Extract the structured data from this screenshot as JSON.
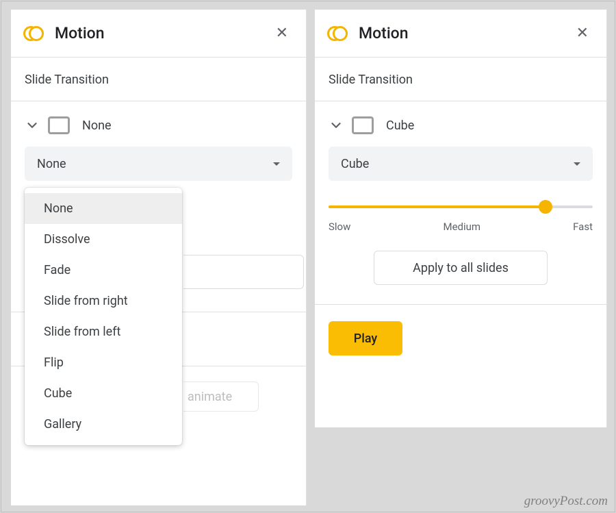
{
  "left": {
    "title": "Motion",
    "section": "Slide Transition",
    "current_transition": "None",
    "select_value": "None",
    "dropdown": {
      "selected_index": 0,
      "options": [
        "None",
        "Dissolve",
        "Fade",
        "Slide from right",
        "Slide from left",
        "Flip",
        "Cube",
        "Gallery"
      ]
    },
    "animate_fragment": "animate"
  },
  "right": {
    "title": "Motion",
    "section": "Slide Transition",
    "current_transition": "Cube",
    "select_value": "Cube",
    "slider": {
      "percent": 82,
      "labels": {
        "slow": "Slow",
        "medium": "Medium",
        "fast": "Fast"
      }
    },
    "apply_label": "Apply to all slides",
    "play_label": "Play"
  },
  "watermark": "groovyPost.com"
}
